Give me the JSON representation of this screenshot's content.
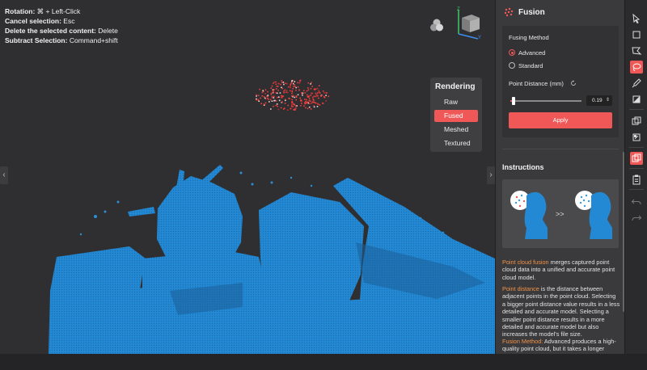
{
  "hints": [
    {
      "label": "Rotation:",
      "value": "⌘ + Left-Click"
    },
    {
      "label": "Cancel selection:",
      "value": "Esc"
    },
    {
      "label": "Delete the selected content:",
      "value": "Delete"
    },
    {
      "label": "Subtract Selection:",
      "value": "Command+shift"
    }
  ],
  "rendering": {
    "title": "Rendering",
    "options": [
      "Raw",
      "Fused",
      "Meshed",
      "Textured"
    ],
    "selected": "Fused"
  },
  "axes": {
    "z": "Z",
    "y": "Y"
  },
  "panel": {
    "title": "Fusion",
    "fusing_method_label": "Fusing Method",
    "methods": [
      "Advanced",
      "Standard"
    ],
    "selected_method": "Advanced",
    "point_distance_label": "Point Distance (mm)",
    "point_distance_value": "0.19",
    "slider_fraction": 0.05,
    "apply_label": "Apply",
    "instructions_title": "Instructions",
    "illus_arrow": ">>",
    "paragraphs": [
      {
        "hl": "Point cloud fusion",
        "text": " merges captured point cloud data into a unified and accurate point cloud model."
      },
      {
        "hl": "Point distance",
        "text": " is the distance between adjacent points in the point cloud. Selecting a bigger point distance value results in a less detailed and accurate model. Selecting a smaller point distance results in a more detailed and accurate model but also increases the model's file size."
      },
      {
        "hl": "Fusion Method:",
        "text": " Advanced produces a high-quality point cloud, but it takes a longer"
      }
    ]
  },
  "toolbar_icons": [
    "select-arrow-icon",
    "rectangle-select-icon",
    "polygon-select-icon",
    "lasso-select-icon",
    "brush-select-icon",
    "gradient-select-icon",
    "invert-select-icon",
    "select-all-icon",
    "fusion-tool-icon",
    "clipboard-icon",
    "undo-icon",
    "redo-icon"
  ],
  "colors": {
    "accent": "#f05858",
    "model": "#2a8fd6",
    "highlight_text": "#f0934a"
  }
}
